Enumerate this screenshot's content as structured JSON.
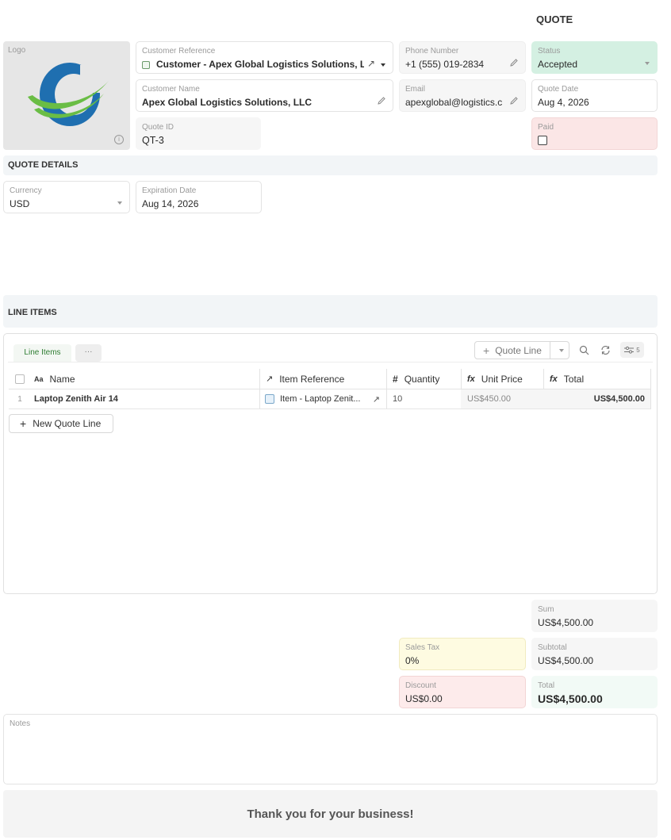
{
  "page_title": "QUOTE",
  "logo": {
    "label": "Logo"
  },
  "customer_reference": {
    "label": "Customer Reference",
    "value": "Customer - Apex Global Logistics Solutions, L..."
  },
  "customer_name": {
    "label": "Customer Name",
    "value": "Apex Global Logistics Solutions, LLC"
  },
  "quote_id": {
    "label": "Quote ID",
    "value": "QT-3"
  },
  "phone": {
    "label": "Phone Number",
    "value": "+1 (555) 019-2834"
  },
  "email": {
    "label": "Email",
    "value": "apexglobal@logistics.c"
  },
  "status": {
    "label": "Status",
    "value": "Accepted"
  },
  "quote_date": {
    "label": "Quote Date",
    "value": "Aug 4, 2026"
  },
  "paid": {
    "label": "Paid",
    "checked": false
  },
  "quote_details": {
    "title": "QUOTE DETAILS",
    "currency": {
      "label": "Currency",
      "value": "USD"
    },
    "expiration": {
      "label": "Expiration Date",
      "value": "Aug 14, 2026"
    }
  },
  "line_items_section": {
    "title": "LINE ITEMS",
    "tab_label": "Line Items",
    "more_label": "···",
    "add_button": "Quote Line",
    "field_count": "5",
    "columns": {
      "name": "Name",
      "item_reference": "Item Reference",
      "quantity": "Quantity",
      "unit_price": "Unit Price",
      "total": "Total"
    },
    "rows": [
      {
        "index": "1",
        "name": "Laptop Zenith Air 14",
        "item_reference": "Item - Laptop Zenit...",
        "quantity": "10",
        "unit_price": "US$450.00",
        "total": "US$4,500.00"
      }
    ],
    "new_line_button": "New Quote Line"
  },
  "totals": {
    "sum": {
      "label": "Sum",
      "value": "US$4,500.00"
    },
    "sales_tax": {
      "label": "Sales Tax",
      "value": "0%"
    },
    "subtotal": {
      "label": "Subtotal",
      "value": "US$4,500.00"
    },
    "discount": {
      "label": "Discount",
      "value": "US$0.00"
    },
    "total": {
      "label": "Total",
      "value": "US$4,500.00"
    }
  },
  "notes": {
    "label": "Notes",
    "value": ""
  },
  "footer": {
    "message": "Thank you for your business!"
  },
  "colors": {
    "status_bg": "#d4f0e2",
    "paid_bg": "#fbe6e6",
    "sales_tax_bg": "#fefbe1",
    "discount_bg": "#fdebeb",
    "total_bg": "#f2faf6",
    "tab_active": "#2e7d32",
    "logo_blue": "#1f6fb0",
    "logo_green": "#6abd45"
  }
}
